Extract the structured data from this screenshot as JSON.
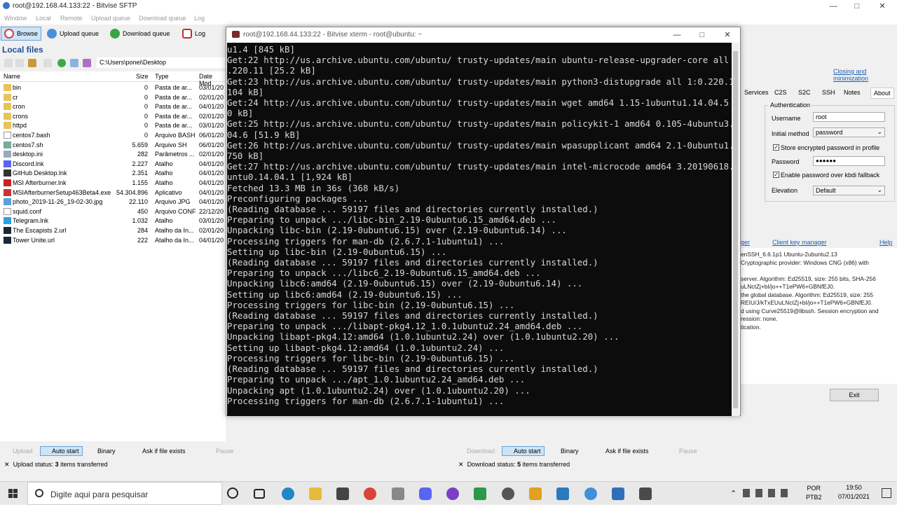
{
  "sftp": {
    "title": "root@192.168.44.133:22 - Bitvise SFTP",
    "menu": [
      "Window",
      "Local",
      "Remote",
      "Upload queue",
      "Download queue",
      "Log"
    ],
    "toolbar": {
      "browse": "Browse",
      "upload_queue": "Upload queue",
      "download_queue": "Download queue",
      "log": "Log"
    },
    "local_header": "Local files",
    "path": "C:\\Users\\ponei\\Desktop",
    "columns": {
      "name": "Name",
      "size": "Size",
      "type": "Type",
      "date": "Date Mod"
    },
    "files": [
      {
        "name": "bin",
        "size": "0",
        "type": "Pasta de ar...",
        "date": "03/01/20",
        "icon": "folder"
      },
      {
        "name": "cr",
        "size": "0",
        "type": "Pasta de ar...",
        "date": "02/01/20",
        "icon": "folder"
      },
      {
        "name": "cron",
        "size": "0",
        "type": "Pasta de ar...",
        "date": "04/01/20",
        "icon": "folder"
      },
      {
        "name": "crons",
        "size": "0",
        "type": "Pasta de ar...",
        "date": "02/01/20",
        "icon": "folder"
      },
      {
        "name": "httpd",
        "size": "0",
        "type": "Pasta de ar...",
        "date": "03/01/20",
        "icon": "folder"
      },
      {
        "name": "centos7.bash",
        "size": "0",
        "type": "Arquivo BASH",
        "date": "06/01/20",
        "icon": "file"
      },
      {
        "name": "centos7.sh",
        "size": "5.659",
        "type": "Arquivo SH",
        "date": "06/01/20",
        "icon": "script"
      },
      {
        "name": "desktop.ini",
        "size": "282",
        "type": "Parâmetros ...",
        "date": "02/01/20",
        "icon": "ini"
      },
      {
        "name": "Discord.lnk",
        "size": "2.227",
        "type": "Atalho",
        "date": "04/01/20",
        "icon": "discord"
      },
      {
        "name": "GitHub Desktop.lnk",
        "size": "2.351",
        "type": "Atalho",
        "date": "04/01/20",
        "icon": "github"
      },
      {
        "name": "MSI Afterburner.lnk",
        "size": "1.155",
        "type": "Atalho",
        "date": "04/01/20",
        "icon": "msi"
      },
      {
        "name": "MSIAfterburnerSetup463Beta4.exe",
        "size": "54.304.896",
        "type": "Aplicativo",
        "date": "04/01/20",
        "icon": "exe"
      },
      {
        "name": "photo_2019-11-26_19-02-30.jpg",
        "size": "22.110",
        "type": "Arquivo JPG",
        "date": "04/01/20",
        "icon": "image"
      },
      {
        "name": "squid.conf",
        "size": "450",
        "type": "Arquivo CONF",
        "date": "22/12/20",
        "icon": "file"
      },
      {
        "name": "Telegram.lnk",
        "size": "1.032",
        "type": "Atalho",
        "date": "03/01/20",
        "icon": "telegram"
      },
      {
        "name": "The Escapists 2.url",
        "size": "284",
        "type": "Atalho da In...",
        "date": "02/01/20",
        "icon": "steam"
      },
      {
        "name": "Tower Unite.url",
        "size": "222",
        "type": "Atalho da In...",
        "date": "04/01/20",
        "icon": "steam"
      }
    ],
    "upload_bar": {
      "upload": "Upload",
      "auto_start": "Auto start",
      "binary": "Binary",
      "ask": "Ask if file exists",
      "pause": "Pause"
    },
    "download_bar": {
      "download": "Download",
      "auto_start": "Auto start",
      "binary": "Binary",
      "ask": "Ask if file exists",
      "pause": "Pause"
    },
    "upload_status": {
      "label": "Upload status:",
      "count": "3",
      "suffix": "items transferred"
    },
    "download_status": {
      "label": "Download status:",
      "count": "5",
      "suffix": "items transferred"
    }
  },
  "terminal": {
    "title": "root@192.168.44.133:22 - Bitvise xterm - root@ubuntu: ~",
    "lines": [
      "u1.4 [845 kB]",
      "Get:22 http://us.archive.ubuntu.com/ubuntu/ trusty-updates/main ubuntu-release-upgrader-core all 1:0",
      ".220.11 [25.2 kB]",
      "Get:23 http://us.archive.ubuntu.com/ubuntu/ trusty-updates/main python3-distupgrade all 1:0.220.11 [",
      "104 kB]",
      "Get:24 http://us.archive.ubuntu.com/ubuntu/ trusty-updates/main wget amd64 1.15-1ubuntu1.14.04.5 [27",
      "0 kB]",
      "Get:25 http://us.archive.ubuntu.com/ubuntu/ trusty-updates/main policykit-1 amd64 0.105-4ubuntu3.14.",
      "04.6 [51.9 kB]",
      "Get:26 http://us.archive.ubuntu.com/ubuntu/ trusty-updates/main wpasupplicant amd64 2.1-0ubuntu1.7 [",
      "750 kB]",
      "Get:27 http://us.archive.ubuntu.com/ubuntu/ trusty-updates/main intel-microcode amd64 3.20190618.0ub",
      "untu0.14.04.1 [1,924 kB]",
      "Fetched 13.3 MB in 36s (368 kB/s)",
      "Preconfiguring packages ...",
      "(Reading database ... 59197 files and directories currently installed.)",
      "Preparing to unpack .../libc-bin_2.19-0ubuntu6.15_amd64.deb ...",
      "Unpacking libc-bin (2.19-0ubuntu6.15) over (2.19-0ubuntu6.14) ...",
      "Processing triggers for man-db (2.6.7.1-1ubuntu1) ...",
      "Setting up libc-bin (2.19-0ubuntu6.15) ...",
      "(Reading database ... 59197 files and directories currently installed.)",
      "Preparing to unpack .../libc6_2.19-0ubuntu6.15_amd64.deb ...",
      "Unpacking libc6:amd64 (2.19-0ubuntu6.15) over (2.19-0ubuntu6.14) ...",
      "Setting up libc6:amd64 (2.19-0ubuntu6.15) ...",
      "Processing triggers for libc-bin (2.19-0ubuntu6.15) ...",
      "(Reading database ... 59197 files and directories currently installed.)",
      "Preparing to unpack .../libapt-pkg4.12_1.0.1ubuntu2.24_amd64.deb ...",
      "Unpacking libapt-pkg4.12:amd64 (1.0.1ubuntu2.24) over (1.0.1ubuntu2.20) ...",
      "Setting up libapt-pkg4.12:amd64 (1.0.1ubuntu2.24) ...",
      "Processing triggers for libc-bin (2.19-0ubuntu6.15) ...",
      "(Reading database ... 59197 files and directories currently installed.)",
      "Preparing to unpack .../apt_1.0.1ubuntu2.24_amd64.deb ...",
      "Unpacking apt (1.0.1ubuntu2.24) over (1.0.1ubuntu2.20) ...",
      "Processing triggers for man-db (2.6.7.1-1ubuntu1) ..."
    ]
  },
  "client": {
    "top_link": "Closing and minimization",
    "tabs": [
      "Services",
      "C2S",
      "S2C",
      "SSH",
      "Notes",
      "About"
    ],
    "auth_legend": "Authentication",
    "username_label": "Username",
    "username_value": "root",
    "method_label": "Initial method",
    "method_value": "password",
    "store_pw_label": "Store encrypted password in profile",
    "password_label": "Password",
    "password_value": "●●●●●●",
    "kbdi_label": "Enable password over kbdi fallback",
    "elevation_label": "Elevation",
    "elevation_value": "Default",
    "links": {
      "manager_partial": "ger",
      "client_key_manager": "Client key manager",
      "help": "Help"
    },
    "log": [
      "enSSH_6.6.1p1 Ubuntu-2ubuntu2.13",
      "Cryptographic provider: Windows CNG (x86) with",
      "",
      "server. Algorithm: Ed25519, size: 255 bits, SHA-256",
      "uLNctZj+bI/jo++T1ePW6+GBNfEJ0.",
      "the global database. Algorithm: Ed25519, size: 255",
      "REIU/J/kTxEUuLNctZj+bI/jo++T1ePW6+GBNfEJ0.",
      "d using Curve25519@libssh. Session encryption and",
      "ression: none.",
      "tication."
    ],
    "exit": "Exit"
  },
  "taskbar": {
    "search_placeholder": "Digite aqui para pesquisar",
    "lang": "POR",
    "layout": "PTB2",
    "time": "19:50",
    "date": "07/01/2021"
  }
}
